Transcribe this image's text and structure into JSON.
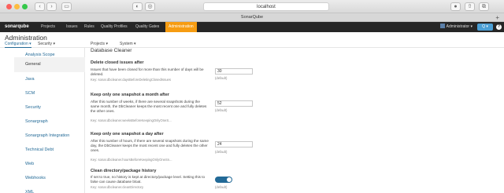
{
  "browser": {
    "address": "localhost",
    "tab_title": "SonarQube",
    "nav_back": "‹",
    "nav_forward": "›",
    "plus": "+"
  },
  "topnav": {
    "logo": "sonarqube",
    "items": [
      "Projects",
      "Issues",
      "Rules",
      "Quality Profiles",
      "Quality Gates",
      "Administration"
    ],
    "active": "Administration",
    "admin_menu": "Administrator ▾",
    "search_label": "Q ▾",
    "help_label": "?",
    "active_color": "#f69c12"
  },
  "page": {
    "title": "Administration",
    "subnav": [
      "Configuration ▾",
      "Security ▾",
      "Projects ▾",
      "System ▾"
    ]
  },
  "sidebar": {
    "items": [
      "Analysis Scope",
      "General",
      "Java",
      "SCM",
      "Security",
      "Sonargraph",
      "Sonargraph Integration",
      "Technical Debt",
      "Web",
      "Webhooks",
      "XML"
    ],
    "active": "General"
  },
  "main": {
    "section_title": "Database Cleaner",
    "settings": [
      {
        "title": "Delete closed issues after",
        "desc": "Issues that have been closed for more than this number of days will be deleted.",
        "key": "Key: sonar.dbcleaner.daysBeforeDeletingClosedIssues",
        "value": "30",
        "default": "(default)"
      },
      {
        "title": "Keep only one snapshot a month after",
        "desc": "After this number of weeks, if there are several snapshots during the same month, the DbCleaner keeps the most recent one and fully deletes the other ones.",
        "key": "Key: sonar.dbcleaner.weeksBeforeKeepingOnlyOneS...",
        "value": "52",
        "default": "(default)"
      },
      {
        "title": "Keep only one snapshot a day after",
        "desc": "After this number of hours, if there are several snapshots during the same day, the DbCleaner keeps the most recent one and fully deletes the other ones.",
        "key": "Key: sonar.dbcleaner.hoursBeforeKeepingOnlyOneSn...",
        "value": "24",
        "default": "(default)"
      },
      {
        "title": "Clean directory/package history",
        "desc": "If set to true, no history is kept at directory/package level. Setting this to false can cause database bloat.",
        "key": "Key: sonar.dbcleaner.cleanDirectory",
        "value": "true",
        "default": "(default)"
      }
    ]
  }
}
